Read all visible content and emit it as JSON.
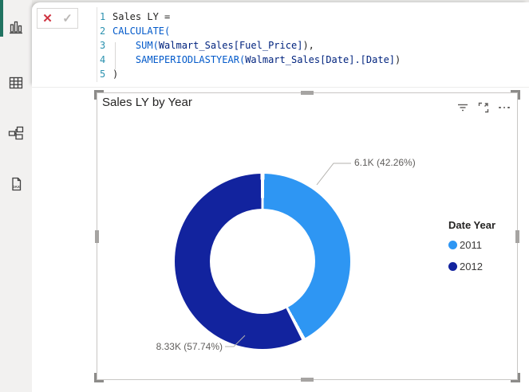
{
  "colors": {
    "accent_green": "#217361",
    "slice_2011": "#2e96f3",
    "slice_2012": "#12239e",
    "leader_gray": "#b3b1ad",
    "label_gray": "#605e5c"
  },
  "sidebar": {
    "items": [
      {
        "icon": "report-view-icon",
        "selected": true
      },
      {
        "icon": "table-view-icon",
        "selected": false
      },
      {
        "icon": "model-view-icon",
        "selected": false
      },
      {
        "icon": "dax-query-view-icon",
        "selected": false
      }
    ]
  },
  "formula_bar": {
    "cancel_glyph": "✕",
    "confirm_glyph": "✓",
    "lines": [
      {
        "num": "1",
        "tokens": [
          {
            "text": "Sales LY =",
            "type": "plain"
          }
        ]
      },
      {
        "num": "2",
        "tokens": [
          {
            "text": "CALCULATE(",
            "type": "func"
          }
        ]
      },
      {
        "num": "3",
        "tokens": [
          {
            "text": "    ",
            "type": "plain"
          },
          {
            "text": "SUM(",
            "type": "func"
          },
          {
            "text": "Walmart_Sales[Fuel_Price]",
            "type": "ident"
          },
          {
            "text": "),",
            "type": "plain"
          }
        ]
      },
      {
        "num": "4",
        "tokens": [
          {
            "text": "    ",
            "type": "plain"
          },
          {
            "text": "SAMEPERIODLASTYEAR(",
            "type": "func"
          },
          {
            "text": "Walmart_Sales[Date].[Date]",
            "type": "ident"
          },
          {
            "text": ")",
            "type": "plain"
          }
        ]
      },
      {
        "num": "5",
        "tokens": [
          {
            "text": ")",
            "type": "plain"
          }
        ]
      }
    ]
  },
  "visual": {
    "title": "Sales LY by Year",
    "header_icons": [
      "filter-icon",
      "focus-mode-icon",
      "more-options-icon"
    ],
    "selected": true
  },
  "chart_data": {
    "type": "pie",
    "subtype": "donut",
    "title": "Sales LY by Year",
    "legend_title": "Date Year",
    "legend_position": "right",
    "categories": [
      "2011",
      "2012"
    ],
    "values": [
      6100,
      8330
    ],
    "values_display": [
      "6.1K",
      "8.33K"
    ],
    "percentages": [
      42.26,
      57.74
    ],
    "labels": [
      "6.1K (42.26%)",
      "8.33K (57.74%)"
    ],
    "colors": [
      "#2e96f3",
      "#12239e"
    ]
  }
}
